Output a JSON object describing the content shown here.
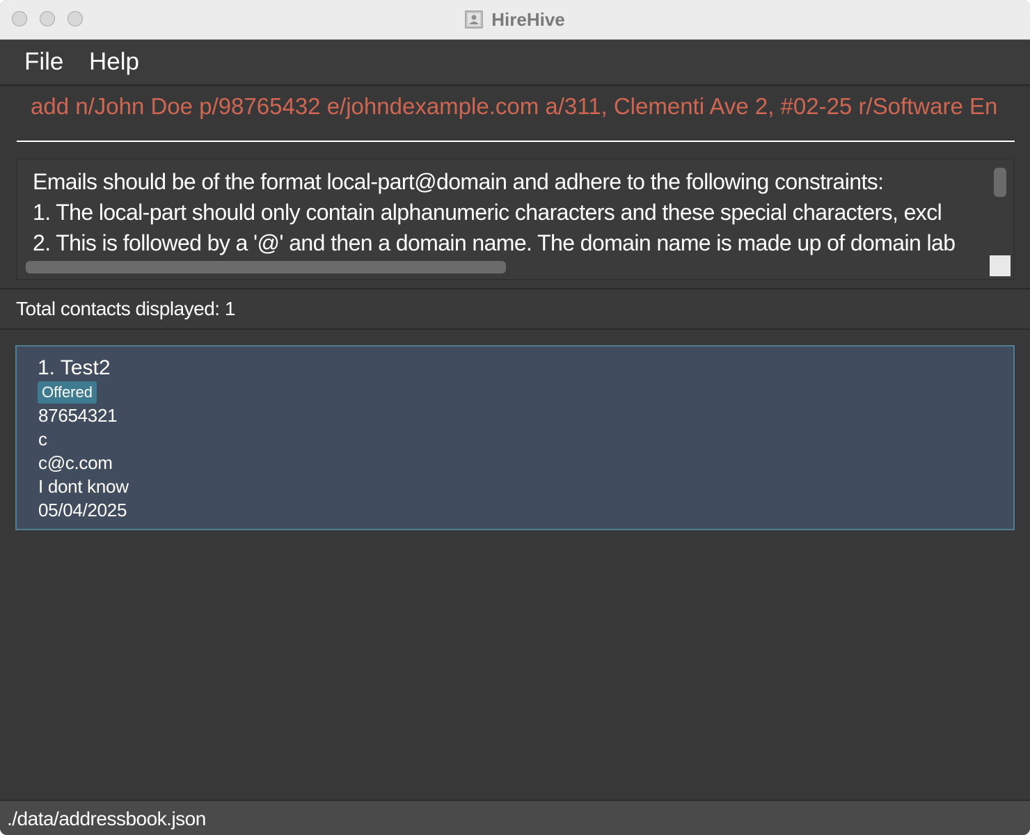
{
  "window": {
    "title": "HireHive",
    "app_icon": "contact-card-icon"
  },
  "menu": {
    "items": [
      {
        "label": "File"
      },
      {
        "label": "Help"
      }
    ]
  },
  "command": {
    "value": "add n/John Doe p/98765432 e/johndexample.com a/311, Clementi Ave 2, #02-25 r/Software En",
    "text_color": "#d06651"
  },
  "result": {
    "lines": [
      "Emails should be of the format local-part@domain and adhere to the following constraints:",
      "1. The local-part should only contain alphanumeric characters and these special characters, excl",
      "2. This is followed by a '@' and then a domain name. The domain name is made up of domain lab"
    ]
  },
  "count": {
    "text": "Total contacts displayed: 1"
  },
  "contacts": [
    {
      "name": "1. Test2",
      "tag": "Offered",
      "phone": "87654321",
      "address": "c",
      "email": "c@c.com",
      "role": "I dont know",
      "date": "05/04/2025"
    }
  ],
  "footer": {
    "path": "./data/addressbook.json"
  },
  "colors": {
    "background": "#383838",
    "card": "#414d5f",
    "card_border": "#4f7f91",
    "tag": "#3e7b91",
    "error_text": "#d06651"
  }
}
